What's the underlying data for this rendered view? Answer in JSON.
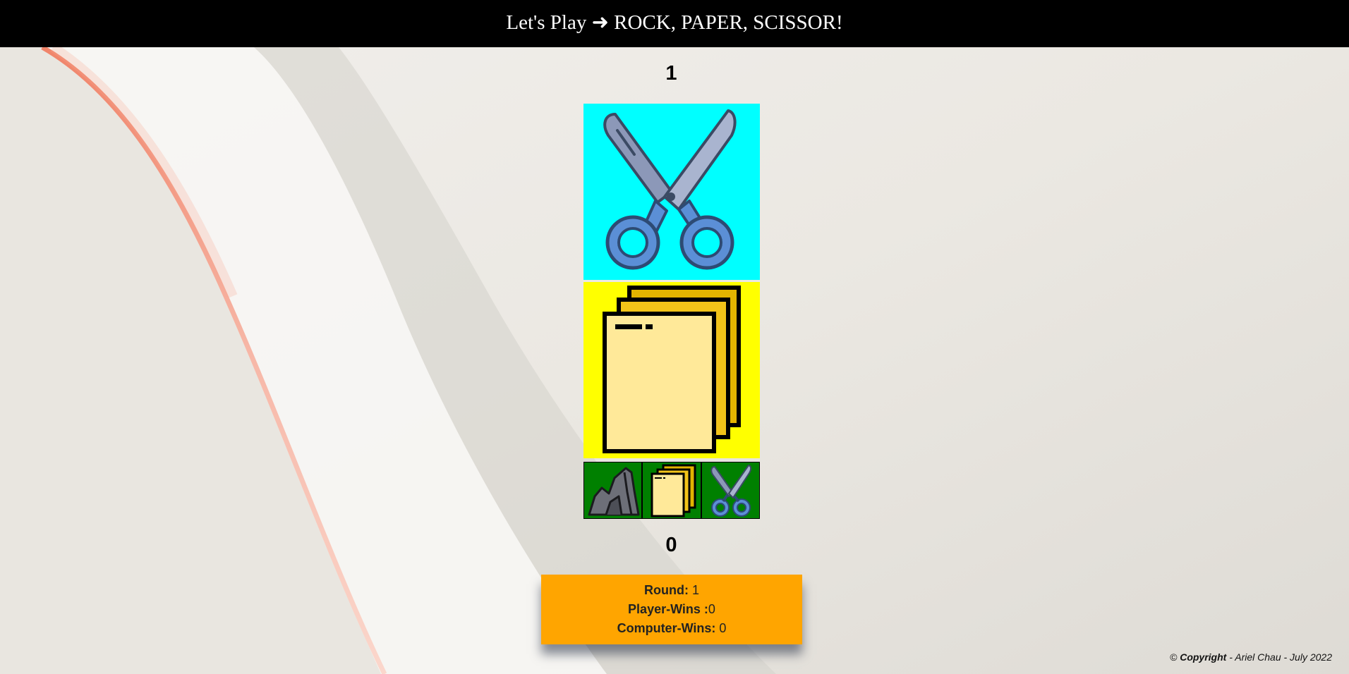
{
  "header": {
    "title": "Let's Play ➜ ROCK, PAPER, SCISSOR!"
  },
  "computer": {
    "score": "1",
    "choice_icon": "scissors-icon",
    "card_color": "#00ffff"
  },
  "player": {
    "score": "0",
    "choice_icon": "paper-icon",
    "card_color": "#ffff00"
  },
  "choices": [
    {
      "name": "rock",
      "icon": "rock-icon"
    },
    {
      "name": "paper",
      "icon": "paper-icon"
    },
    {
      "name": "scissors",
      "icon": "scissors-icon"
    }
  ],
  "choice_bg_color": "#008000",
  "stats": {
    "round_label": "Round:",
    "round_value": " 1",
    "player_wins_label": "Player-Wins :",
    "player_wins_value": "0",
    "computer_wins_label": "Computer-Wins:",
    "computer_wins_value": " 0",
    "bg_color": "#ffa500"
  },
  "footer": {
    "symbol": "©",
    "copyright_word": "Copyright",
    "rest": " - Ariel Chau - July 2022"
  }
}
